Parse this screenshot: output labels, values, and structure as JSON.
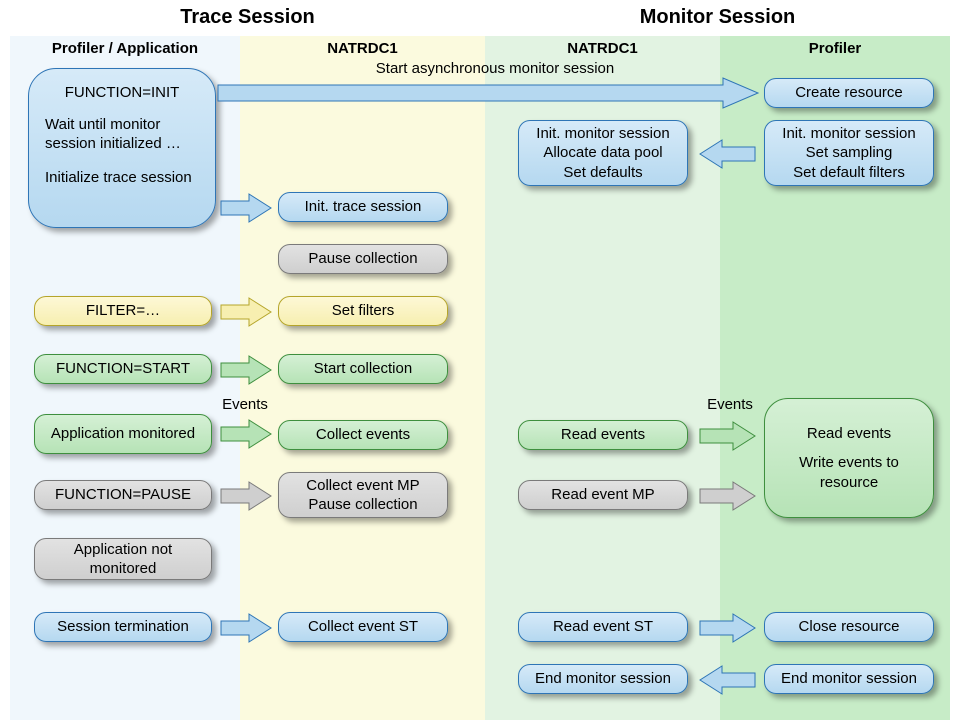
{
  "headers": {
    "trace_title": "Trace Session",
    "monitor_title": "Monitor Session",
    "col1": "Profiler  /  Application",
    "col2": "NATRDC1",
    "col3": "NATRDC1",
    "col4": "Profiler"
  },
  "labels": {
    "start_async": "Start asynchronous  monitor session",
    "events_left": "Events",
    "events_right": "Events"
  },
  "boxes": {
    "init_block": {
      "l1": "FUNCTION=INIT",
      "l2": "Wait until monitor session initialized …",
      "l3": "Initialize trace session"
    },
    "create_resource": "Create resource",
    "mon_init_right": {
      "l1": "Init. monitor session",
      "l2": "Set sampling",
      "l3": "Set default filters"
    },
    "mon_init_left": {
      "l1": "Init. monitor session",
      "l2": "Allocate data pool",
      "l3": "Set defaults"
    },
    "init_trace": "Init. trace session",
    "pause_collection1": "Pause collection",
    "filter": "FILTER=…",
    "set_filters": "Set filters",
    "func_start": "FUNCTION=START",
    "start_collection": "Start collection",
    "app_mon": "Application monitored",
    "collect_events": "Collect events",
    "read_events_small": "Read events",
    "read_events_big": {
      "l1": "Read events",
      "l2": "Write events to resource"
    },
    "func_pause": "FUNCTION=PAUSE",
    "collect_mp": {
      "l1": "Collect event MP",
      "l2": "Pause collection"
    },
    "read_mp": "Read event MP",
    "app_not_mon": "Application not monitored",
    "sess_term": "Session termination",
    "collect_st": "Collect event ST",
    "read_st": "Read event ST",
    "close_resource": "Close resource",
    "end_mon_left": "End monitor session",
    "end_mon_right": "End monitor session"
  },
  "colors": {
    "bg_col1": "#f0f7fc",
    "bg_col2": "#fbfade",
    "bg_col3": "#e2f3e2",
    "bg_col4": "#c7ecc7",
    "arrow_blue": {
      "fill": "#b5d8f0",
      "stroke": "#2e75b6"
    },
    "arrow_yellow": {
      "fill": "#f7efb0",
      "stroke": "#b5a52a"
    },
    "arrow_green": {
      "fill": "#b6e3b6",
      "stroke": "#3e8f3e"
    },
    "arrow_gray": {
      "fill": "#cfcfcf",
      "stroke": "#7a7a7a"
    }
  }
}
